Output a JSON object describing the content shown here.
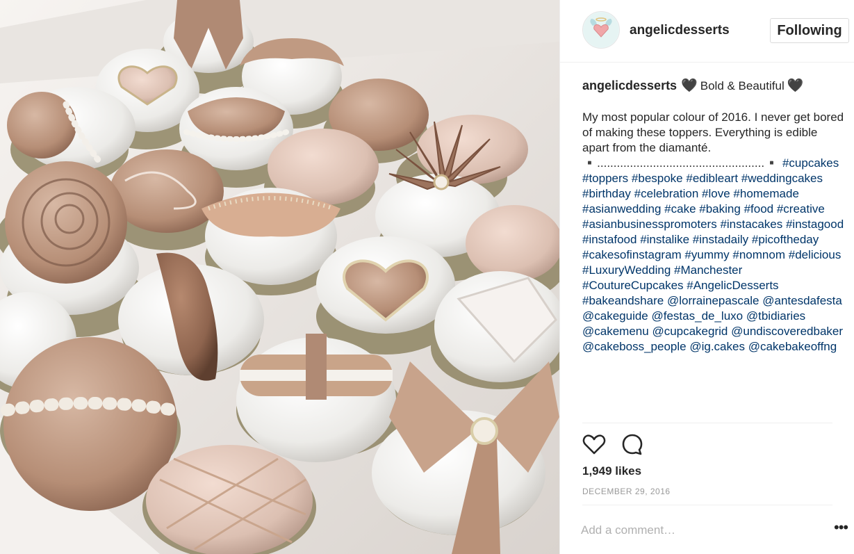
{
  "header": {
    "username": "angelicdesserts",
    "follow_label": "Following",
    "avatar_text": "angelic desserts"
  },
  "caption": {
    "username": "angelicdesserts",
    "heart": "🖤",
    "title": "Bold & Beautiful",
    "body": "My most popular colour of 2016. I never get bored of making these toppers. Everything is edible apart from the diamanté.",
    "dots": "▪️...................................................▪️",
    "tags": [
      "#cupcakes",
      "#toppers",
      "#bespoke",
      "#edibleart",
      "#weddingcakes",
      "#birthday",
      "#celebration",
      "#love",
      "#homemade",
      "#asianwedding",
      "#cake",
      "#baking",
      "#food",
      "#creative",
      "#asianbusinesspromoters",
      "#instacakes",
      "#instagood",
      "#instafood",
      "#instalike",
      "#instadaily",
      "#picoftheday",
      "#cakesofinstagram",
      "#yummy",
      "#nomnom",
      "#delicious",
      "#LuxuryWedding",
      "#Manchester",
      "#CoutureCupcakes",
      "#AngelicDesserts",
      "#bakeandshare",
      "@lorrainepascale",
      "@antesdafesta",
      "@cakeguide",
      "@festas_de_luxo",
      "@tbidiaries",
      "@cakemenu",
      "@cupcakegrid",
      "@undiscoveredbaker",
      "@cakeboss_people",
      "@ig.cakes",
      "@cakebakeoffng"
    ]
  },
  "likes": "1,949 likes",
  "date": "DECEMBER 29, 2016",
  "comment": {
    "placeholder": "Add a comment…"
  },
  "more": "•••",
  "colors": {
    "link": "#003569",
    "date": "#999999",
    "border": "#efefef"
  }
}
